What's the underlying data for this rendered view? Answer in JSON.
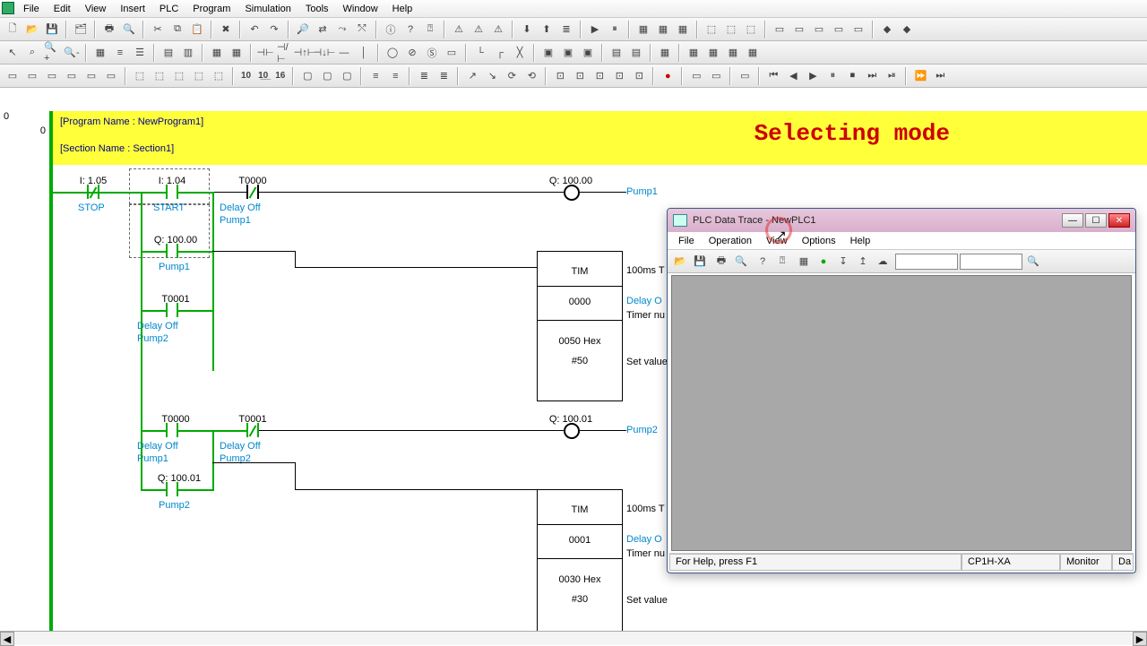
{
  "main_menu": [
    "File",
    "Edit",
    "View",
    "Insert",
    "PLC",
    "Program",
    "Simulation",
    "Tools",
    "Window",
    "Help"
  ],
  "header": {
    "program_line": "[Program Name : NewProgram1]",
    "section_line": "[Section Name : Section1]",
    "overlay": "Selecting mode",
    "rung0": "0",
    "rung0b": "0"
  },
  "ladder": {
    "c_stop_addr": "I: 1.05",
    "c_stop_lbl": "STOP",
    "c_start_addr": "I: 1.04",
    "c_start_lbl": "START",
    "c_t0_addr": "T0000",
    "c_t0_lbl1": "Delay Off",
    "c_t0_lbl2": "Pump1",
    "c_q0_addr": "Q: 100.00",
    "c_q0_lbl": "Pump1",
    "c_t1_addr": "T0001",
    "c_t1_lbl1": "Delay Off",
    "c_t1_lbl2": "Pump2",
    "coil1_addr": "Q: 100.00",
    "coil1_lbl": "Pump1",
    "box1_op": "TIM",
    "box1_n": "0000",
    "box1_hex": "0050 Hex",
    "box1_val": "#50",
    "right1a": "100ms T",
    "right1b": "Delay O",
    "right1c": "Timer nu",
    "right1d": "Set value",
    "c_t0b_addr": "T0000",
    "c_t0b_lbl1": "Delay Off",
    "c_t0b_lbl2": "Pump1",
    "c_t1b_addr": "T0001",
    "c_t1b_lbl1": "Delay Off",
    "c_t1b_lbl2": "Pump2",
    "coil2_addr": "Q: 100.01",
    "coil2_lbl": "Pump2",
    "c_q1_addr": "Q: 100.01",
    "c_q1_lbl": "Pump2",
    "box2_op": "TIM",
    "box2_n": "0001",
    "box2_hex": "0030 Hex",
    "box2_val": "#30",
    "right2a": "100ms T",
    "right2b": "Delay O",
    "right2c": "Timer nu",
    "right2d": "Set value"
  },
  "child": {
    "title": "PLC Data Trace - NewPLC1",
    "menu": [
      "File",
      "Operation",
      "View",
      "Options",
      "Help"
    ],
    "status_help": "For Help, press F1",
    "status_plc": "CP1H-XA",
    "status_mode": "Monitor",
    "status_extra": "Da"
  }
}
